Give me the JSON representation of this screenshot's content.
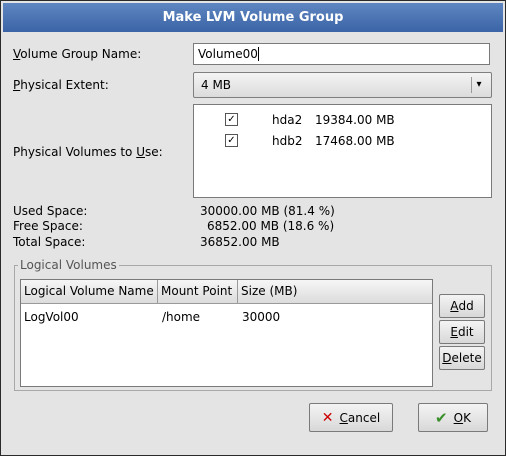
{
  "window": {
    "title": "Make LVM Volume Group"
  },
  "form": {
    "vg_name_label_prefix": "V",
    "vg_name_label_rest": "olume Group Name:",
    "vg_name_value": "Volume00",
    "pe_label_prefix": "P",
    "pe_label_rest": "hysical Extent:",
    "pe_value": "4 MB",
    "pv_label_prefix": "Physical Volumes to ",
    "pv_label_u": "U",
    "pv_label_rest": "se:",
    "physical_volumes": [
      {
        "name": "hda2",
        "size": "19384.00 MB",
        "checked": true
      },
      {
        "name": "hdb2",
        "size": "17468.00 MB",
        "checked": true
      }
    ]
  },
  "space": {
    "used_label": "Used Space:",
    "used_value": "30000.00 MB  (81.4 %)",
    "free_label": "Free Space:",
    "free_value": "6852.00 MB  (18.6 %)",
    "total_label": "Total Space:",
    "total_value": "36852.00 MB"
  },
  "logical_volumes": {
    "frame_title": "Logical Volumes",
    "columns": [
      "Logical Volume Name",
      "Mount Point",
      "Size (MB)"
    ],
    "rows": [
      {
        "name": "LogVol00",
        "mount": "/home",
        "size": "30000"
      }
    ],
    "add_prefix": "A",
    "add_rest": "dd",
    "edit_prefix": "E",
    "edit_rest": "dit",
    "delete_prefix": "D",
    "delete_rest": "elete"
  },
  "buttons": {
    "cancel_prefix": "C",
    "cancel_rest": "ancel",
    "ok_prefix": "O",
    "ok_rest": "K"
  }
}
